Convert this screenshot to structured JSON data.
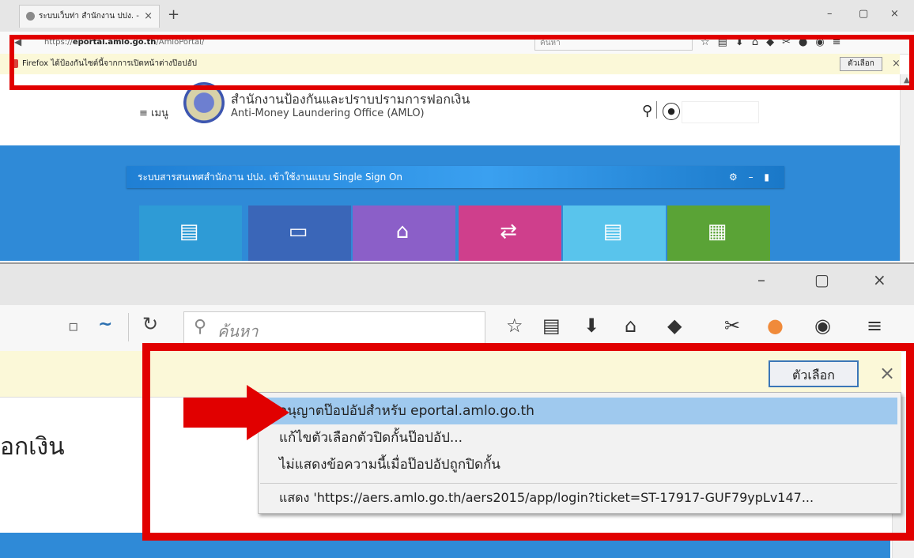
{
  "top_browser": {
    "tab_title": "ระบบเว็บท่า สำนักงาน ปปง. -",
    "tab_close": "×",
    "new_tab": "+",
    "window_controls": [
      "–",
      "▢",
      "×"
    ],
    "url_prefix": "https://",
    "url_domain": "eportal.amlo.go.th",
    "url_path": "/AmloPortal/",
    "search_placeholder": "ค้นหา",
    "notification_text": "Firefox ได้ป้องกันไซต์นี้จากการเปิดหน้าต่างป๊อปอัป",
    "options_button": "ตัวเลือก",
    "close": "×"
  },
  "site": {
    "menu_label": "≡ เมนู",
    "org_name_th": "สำนักงานป้องกันและปราบปรามการฟอกเงิน",
    "org_name_en": "Anti-Money Laundering Office (AMLO)",
    "sso_title": "ระบบสารสนเทศสำนักงาน ปปง. เข้าใช้งานแบบ Single Sign On",
    "sso_controls": "⚙ – ▮",
    "tiles": [
      {
        "icon": "document-13-icon",
        "color": "#2e9bd6",
        "glyph": "▤"
      },
      {
        "icon": "id-card-icon",
        "color": "#3a66b8",
        "glyph": "▭"
      },
      {
        "icon": "person-scan-icon",
        "color": "#8b5fc8",
        "glyph": "⌂"
      },
      {
        "icon": "file-transfer-icon",
        "color": "#cf3f8c",
        "glyph": "⇄"
      },
      {
        "icon": "document-icon",
        "color": "#59c4ec",
        "glyph": "▤"
      },
      {
        "icon": "report-icon",
        "color": "#5aa336",
        "glyph": "▦"
      }
    ]
  },
  "zoom_browser": {
    "window_controls": [
      "–",
      "▢",
      "×"
    ],
    "search_placeholder": "ค้นหา",
    "options_button": "ตัวเลือก",
    "close": "×",
    "page_text": "อกเงิน",
    "popup_menu": {
      "items": [
        "อนุญาตป๊อปอัปสำหรับ eportal.amlo.go.th",
        "แก้ไขตัวเลือกตัวปิดกั้นป๊อปอัป...",
        "ไม่แสดงข้อความนี้เมื่อป๊อปอัปถูกปิดกั้น"
      ],
      "show_link": "แสดง 'https://aers.amlo.go.th/aers2015/app/login?ticket=ST-17917-GUF79ypLv147..."
    }
  },
  "colors": {
    "highlight_red": "#e10000",
    "site_blue": "#2f8ad7",
    "notification_bg": "#fbf8d8",
    "menu_selected": "#9fc9ee"
  }
}
